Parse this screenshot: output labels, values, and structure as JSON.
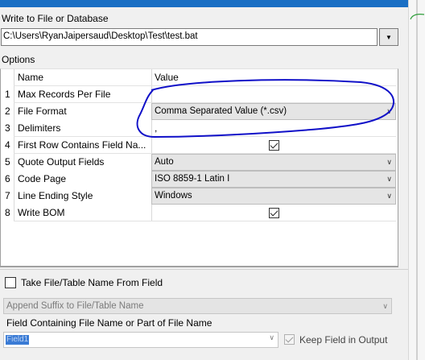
{
  "write_section": {
    "title": "Write to File or Database",
    "path_value": "C:\\Users\\RyanJaipersaud\\Desktop\\Test\\test.bat"
  },
  "options_section": {
    "title": "Options",
    "header_name": "Name",
    "header_value": "Value",
    "rows": [
      {
        "num": "1",
        "name": "Max Records Per File",
        "value": ""
      },
      {
        "num": "2",
        "name": "File Format",
        "value": "Comma Separated Value (*.csv)"
      },
      {
        "num": "3",
        "name": "Delimiters",
        "value": ","
      },
      {
        "num": "4",
        "name": "First Row Contains Field Na...",
        "checked": true
      },
      {
        "num": "5",
        "name": "Quote Output Fields",
        "value": "Auto"
      },
      {
        "num": "6",
        "name": "Code Page",
        "value": "ISO 8859-1 Latin I"
      },
      {
        "num": "7",
        "name": "Line Ending Style",
        "value": "Windows"
      },
      {
        "num": "8",
        "name": "Write BOM",
        "checked": true
      }
    ]
  },
  "filename_section": {
    "take_label": "Take File/Table Name From Field",
    "take_checked": false,
    "suffix_option": "Append Suffix to File/Table Name",
    "field_label": "Field Containing File Name or Part of File Name",
    "field_value": "Field1",
    "keep_label": "Keep Field in Output",
    "keep_checked": true
  },
  "colors": {
    "accent_bar": "#1a6fc4",
    "annotation_ink": "#1010c8",
    "selection": "#3a7bd5"
  },
  "icons": {
    "dropdown": "chevron-down-icon",
    "checkbox": "checkmark-icon"
  }
}
